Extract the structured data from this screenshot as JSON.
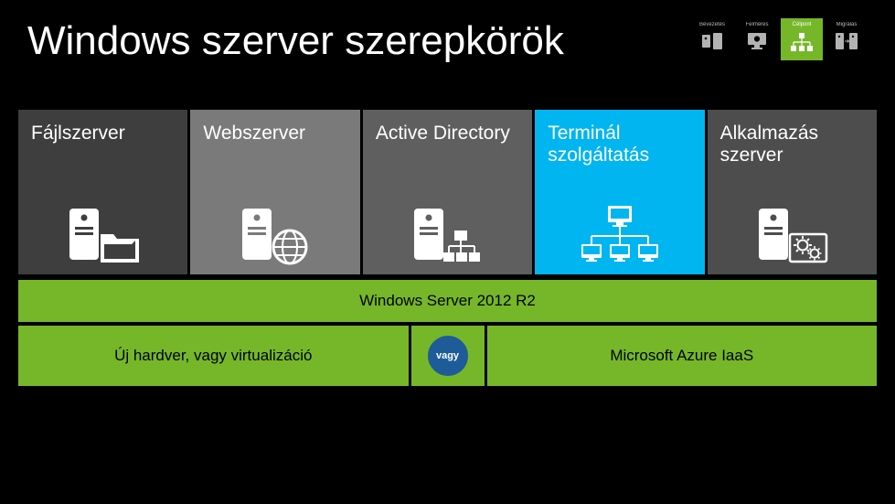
{
  "title": "Windows szerver szerepkörök",
  "nav": [
    {
      "label": "Bevezetés"
    },
    {
      "label": "Felmérés"
    },
    {
      "label": "Célpont"
    },
    {
      "label": "Migrálás"
    }
  ],
  "roles": [
    {
      "name": "Fájlszerver"
    },
    {
      "name": "Webszerver"
    },
    {
      "name": "Active Directory"
    },
    {
      "name": "Terminál szolgáltatás"
    },
    {
      "name": "Alkalmazás szerver"
    }
  ],
  "banner": "Windows Server 2012 R2",
  "bottom_left": "Új hardver, vagy virtualizáció",
  "bottom_mid": "vagy",
  "bottom_right": "Microsoft Azure IaaS"
}
